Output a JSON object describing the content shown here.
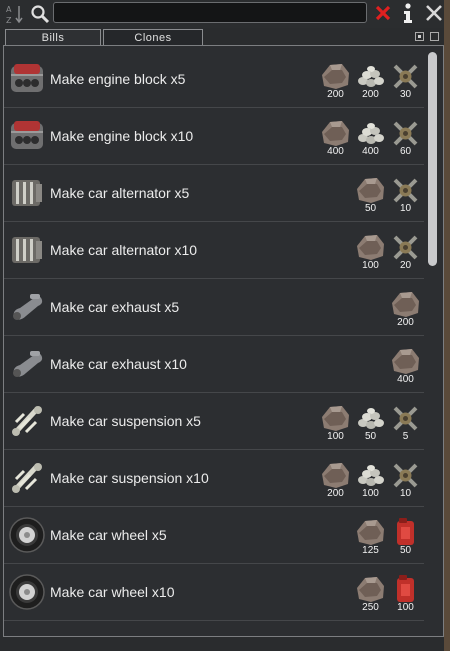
{
  "search": {
    "value": "",
    "placeholder": ""
  },
  "tabs": [
    {
      "label": "Bills"
    },
    {
      "label": "Clones"
    }
  ],
  "colors": {
    "steel": "#8b7d73",
    "plasteel": "#c8c8c0",
    "component": "#8a7a60",
    "chemfuel": "#c0302a"
  },
  "bills": [
    {
      "label": "Make engine block x5",
      "icon": "engine-block-icon",
      "costs": [
        {
          "icon": "steel-icon",
          "amount": "200"
        },
        {
          "icon": "plasteel-icon",
          "amount": "200"
        },
        {
          "icon": "component-icon",
          "amount": "30"
        }
      ]
    },
    {
      "label": "Make engine block x10",
      "icon": "engine-block-icon",
      "costs": [
        {
          "icon": "steel-icon",
          "amount": "400"
        },
        {
          "icon": "plasteel-icon",
          "amount": "400"
        },
        {
          "icon": "component-icon",
          "amount": "60"
        }
      ]
    },
    {
      "label": "Make car alternator x5",
      "icon": "alternator-icon",
      "costs": [
        {
          "icon": "steel-icon",
          "amount": "50"
        },
        {
          "icon": "component-icon",
          "amount": "10"
        }
      ]
    },
    {
      "label": "Make car alternator x10",
      "icon": "alternator-icon",
      "costs": [
        {
          "icon": "steel-icon",
          "amount": "100"
        },
        {
          "icon": "component-icon",
          "amount": "20"
        }
      ]
    },
    {
      "label": "Make car exhaust x5",
      "icon": "exhaust-icon",
      "costs": [
        {
          "icon": "steel-icon",
          "amount": "200"
        }
      ]
    },
    {
      "label": "Make car exhaust x10",
      "icon": "exhaust-icon",
      "costs": [
        {
          "icon": "steel-icon",
          "amount": "400"
        }
      ]
    },
    {
      "label": "Make car suspension x5",
      "icon": "suspension-icon",
      "costs": [
        {
          "icon": "steel-icon",
          "amount": "100"
        },
        {
          "icon": "plasteel-icon",
          "amount": "50"
        },
        {
          "icon": "component-icon",
          "amount": "5"
        }
      ]
    },
    {
      "label": "Make car suspension x10",
      "icon": "suspension-icon",
      "costs": [
        {
          "icon": "steel-icon",
          "amount": "200"
        },
        {
          "icon": "plasteel-icon",
          "amount": "100"
        },
        {
          "icon": "component-icon",
          "amount": "10"
        }
      ]
    },
    {
      "label": "Make car wheel x5",
      "icon": "wheel-icon",
      "costs": [
        {
          "icon": "steel-icon",
          "amount": "125"
        },
        {
          "icon": "chemfuel-icon",
          "amount": "50"
        }
      ]
    },
    {
      "label": "Make car wheel x10",
      "icon": "wheel-icon",
      "costs": [
        {
          "icon": "steel-icon",
          "amount": "250"
        },
        {
          "icon": "chemfuel-icon",
          "amount": "100"
        }
      ]
    }
  ]
}
